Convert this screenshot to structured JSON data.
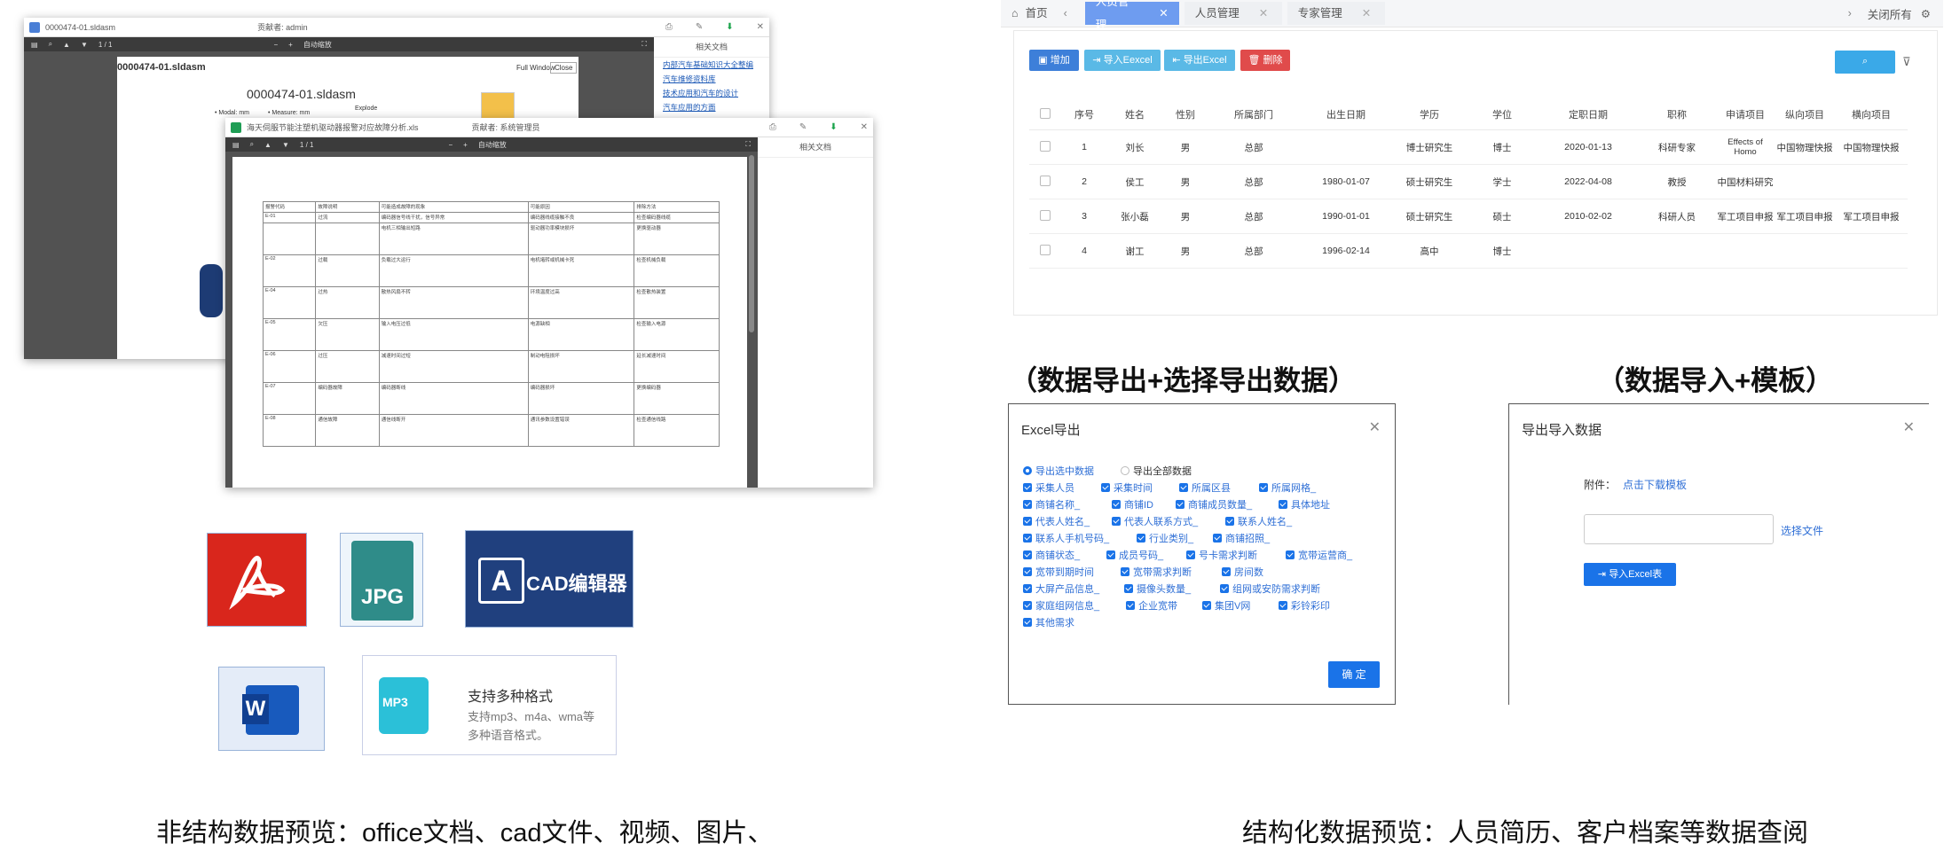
{
  "left": {
    "win1": {
      "filename": "0000474-01.sldasm",
      "user": "贡献者: admin",
      "page_indicator": "1 / 1",
      "zoom": "自动缩放",
      "doc_title": "0000474-01.sldasm",
      "big_title": "0000474-01.sldasm",
      "units": "• Modal: mm",
      "measure": "• Measure: mm",
      "explode": "Explode",
      "full_window": "Full Window",
      "close": "Close",
      "related_header": "相关文档",
      "related": [
        "内部汽车基础知识大全整编",
        "汽车维修资料库",
        "技术应用和汽车的设计",
        "汽车应用的方面"
      ]
    },
    "win2": {
      "filename": "海天伺服节能注塑机驱动器报警对应故障分析.xls",
      "user": "贡献者: 系统管理员",
      "page_indicator": "1 / 1",
      "zoom": "自动缩放",
      "related_header": "相关文档",
      "table_header": [
        "报警代码",
        "故障说明",
        "可能造成故障的现象",
        "可能原因",
        "排除方法"
      ],
      "rows": [
        [
          "E-01",
          "过流",
          "编码器信号线干扰，信号异常",
          "编码器线缆接触不良",
          "检查编码器线缆"
        ],
        [
          "",
          "",
          "电机三相输出短路",
          "驱动器功率模块损坏",
          "更换驱动器"
        ],
        [
          "E-02",
          "过载",
          "负载过大运行",
          "电机堵转或机械卡死",
          "检查机械负载"
        ],
        [
          "E-04",
          "过热",
          "散热风扇不转",
          "环境温度过高",
          "检查散热装置"
        ],
        [
          "E-05",
          "欠压",
          "输入电压过低",
          "电源缺相",
          "检查输入电源"
        ],
        [
          "E-06",
          "过压",
          "减速时间过短",
          "制动电阻损坏",
          "延长减速时间"
        ],
        [
          "E-07",
          "编码器故障",
          "编码器断线",
          "编码器损坏",
          "更换编码器"
        ],
        [
          "E-08",
          "通信故障",
          "通信线断开",
          "通讯参数设置错误",
          "检查通信线路"
        ]
      ]
    },
    "formats": {
      "jpg": "JPG",
      "cad": "CAD编辑器",
      "audio_title": "支持多种格式",
      "audio_desc1": "支持mp3、m4a、wma等",
      "audio_desc2": "多种语音格式。",
      "mp3": "MP3",
      "word_letter": "W"
    },
    "caption": "非结构数据预览：office文档、cad文件、视频、图片、"
  },
  "right": {
    "tabs": {
      "home": "首页",
      "active": "人员管理",
      "t2": "人员管理",
      "t3": "专家管理",
      "close_all": "关闭所有"
    },
    "toolbar": {
      "add": "增加",
      "import": "导入Eexcel",
      "export": "导出Excel",
      "delete": "删除"
    },
    "columns": [
      "序号",
      "姓名",
      "性别",
      "所属部门",
      "出生日期",
      "学历",
      "学位",
      "定职日期",
      "职称",
      "申请项目",
      "纵向项目",
      "横向项目"
    ],
    "rows": [
      [
        "1",
        "刘长",
        "男",
        "总部",
        "",
        "博士研究生",
        "博士",
        "2020-01-13",
        "科研专家",
        "Effects of Homo",
        "中国物理快报",
        "中国物理快报"
      ],
      [
        "2",
        "侯工",
        "男",
        "总部",
        "1980-01-07",
        "硕士研究生",
        "学士",
        "2022-04-08",
        "教授",
        "中国材料研究",
        "",
        ""
      ],
      [
        "3",
        "张小磊",
        "男",
        "总部",
        "1990-01-01",
        "硕士研究生",
        "硕士",
        "2010-02-02",
        "科研人员",
        "军工项目申报",
        "军工项目申报",
        "军工项目申报"
      ],
      [
        "4",
        "谢工",
        "男",
        "总部",
        "1996-02-14",
        "高中",
        "博士",
        "",
        "",
        "",
        "",
        ""
      ]
    ],
    "heading_export": "（数据导出+选择导出数据）",
    "heading_import": "（数据导入+模板）",
    "export_dialog": {
      "title": "Excel导出",
      "radio_selected": "导出选中数据",
      "radio_all": "导出全部数据",
      "fields": [
        [
          "采集人员",
          "采集时间",
          "所属区县",
          "所属网格_"
        ],
        [
          "商铺名称_",
          "商铺ID",
          "商铺成员数量_",
          "具体地址"
        ],
        [
          "代表人姓名_",
          "代表人联系方式_",
          "联系人姓名_"
        ],
        [
          "联系人手机号码_",
          "行业类别_",
          "商铺招照_"
        ],
        [
          "商铺状态_",
          "成员号码_",
          "号卡需求判断",
          "宽带运营商_"
        ],
        [
          "宽带到期时间",
          "宽带需求判断",
          "房间数"
        ],
        [
          "大屏产品信息_",
          "摄像头数量_",
          "组网或安防需求判断"
        ],
        [
          "家庭组网信息_",
          "企业宽带",
          "集团V网",
          "彩铃彩印"
        ],
        [
          "其他需求"
        ]
      ],
      "confirm": "确 定"
    },
    "import_dialog": {
      "title": "导出导入数据",
      "attach_label": "附件：",
      "download_link": "点击下载模板",
      "choose_file": "选择文件",
      "import_btn": "导入Excel表"
    },
    "caption": "结构化数据预览：人员简历、客户档案等数据查阅"
  },
  "colors": {
    "primary": "#1a73e8",
    "tab_active": "#6e9cf0",
    "btn_blue": "#3d7fd9",
    "btn_teal": "#5ab9e6",
    "btn_red": "#e04b4b",
    "link": "#2f6fd6"
  }
}
